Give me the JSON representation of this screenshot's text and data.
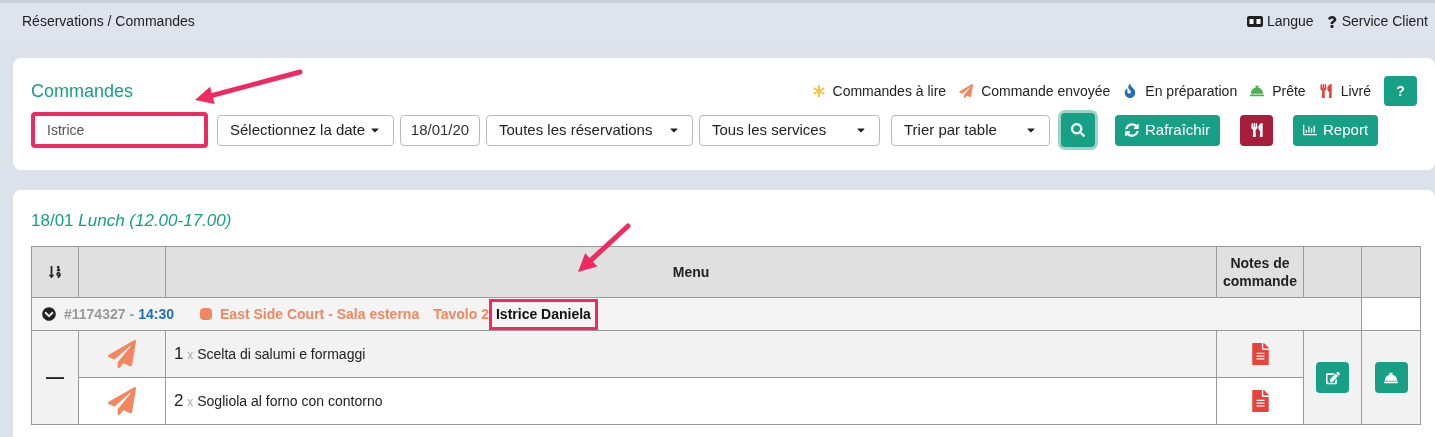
{
  "breadcrumb": "Réservations / Commandes",
  "top_links": [
    {
      "kind": "language",
      "label": "Langue"
    },
    {
      "kind": "help",
      "label": "Service Client"
    }
  ],
  "orders_panel": {
    "title": "Commandes",
    "legend": [
      {
        "kind": "to_read",
        "label": "Commandes à lire"
      },
      {
        "kind": "sent",
        "label": "Commande envoyée"
      },
      {
        "kind": "preparing",
        "label": "En préparation"
      },
      {
        "kind": "ready",
        "label": "Prête"
      },
      {
        "kind": "delivered",
        "label": "Livré"
      }
    ],
    "help_button": "?",
    "search": {
      "value": "Istrice",
      "highlighted": true
    },
    "filters": [
      {
        "kind": "select",
        "value": "Sélectionnez la date"
      },
      {
        "kind": "input",
        "value": "18/01/20"
      },
      {
        "kind": "select",
        "value": "Toutes les réservations"
      },
      {
        "kind": "select",
        "value": "Tous les services"
      },
      {
        "kind": "select",
        "value": "Trier par table"
      }
    ],
    "buttons": [
      {
        "kind": "search"
      },
      {
        "kind": "refresh",
        "label": "Rafraîchir"
      },
      {
        "kind": "kitchen"
      },
      {
        "kind": "report",
        "label": "Report"
      }
    ]
  },
  "service": {
    "date": "18/01",
    "name": "Lunch (12.00-17.00)"
  },
  "table": {
    "columns": [
      {
        "kind": "sort"
      },
      {
        "kind": "blank"
      },
      {
        "kind": "text",
        "label": "Menu"
      },
      {
        "kind": "text",
        "label": "Notes de commande"
      },
      {
        "kind": "blank"
      },
      {
        "kind": "blank"
      }
    ],
    "group": {
      "order_no": "#1174327",
      "separator": "-",
      "time": "14:30",
      "location": "East Side Court - Sala esterna",
      "table": "Tavolo 2",
      "customer": "Istrice Daniela",
      "highlighted": true,
      "expanded": true,
      "collapse_mark": "—"
    },
    "items": [
      {
        "kind": "sent",
        "qty": "1",
        "times": "x",
        "name": "Scelta di salumi e formaggi"
      },
      {
        "kind": "sent",
        "qty": "2",
        "times": "x",
        "name": "Sogliola al forno con contorno"
      }
    ]
  }
}
